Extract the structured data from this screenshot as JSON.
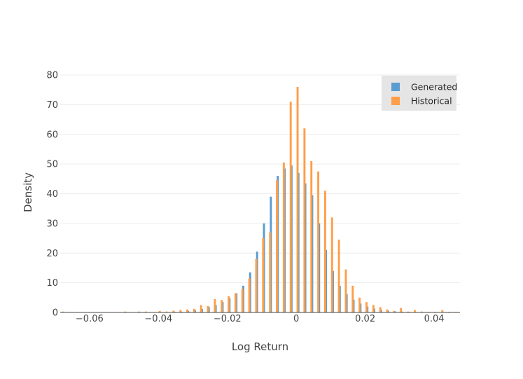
{
  "chart_data": {
    "type": "bar",
    "title": "",
    "xlabel": "Log Return",
    "ylabel": "Density",
    "xlim": [
      -0.0685,
      0.0475
    ],
    "ylim": [
      0,
      80
    ],
    "grid": true,
    "legend_position": "top-right",
    "x_ticks": [
      -0.06,
      -0.04,
      -0.02,
      0,
      0.02,
      0.04
    ],
    "x_tick_labels": [
      "−0.06",
      "−0.04",
      "−0.02",
      "0",
      "0.02",
      "0.04"
    ],
    "y_ticks": [
      0,
      10,
      20,
      30,
      40,
      50,
      60,
      70,
      80
    ],
    "y_tick_labels": [
      "0",
      "10",
      "20",
      "30",
      "40",
      "50",
      "60",
      "70",
      "80"
    ],
    "colors": {
      "Generated": "#5a9bd0",
      "Historical": "#ff9e48"
    },
    "series": [
      {
        "name": "Generated",
        "x": [
          -0.035,
          -0.033,
          -0.031,
          -0.029,
          -0.027,
          -0.025,
          -0.023,
          -0.021,
          -0.019,
          -0.017,
          -0.015,
          -0.013,
          -0.011,
          -0.009,
          -0.007,
          -0.005,
          -0.003,
          -0.001,
          0.001,
          0.003,
          0.005,
          0.007,
          0.009,
          0.011,
          0.013,
          0.015,
          0.017,
          0.019,
          0.021,
          0.023,
          0.025,
          0.027,
          0.029,
          0.031,
          0.033,
          0.035,
          0.037
        ],
        "values": [
          0.2,
          0.3,
          0.5,
          0.8,
          1.2,
          1.8,
          2.5,
          3.5,
          4.8,
          6.5,
          9.0,
          13.5,
          20.5,
          30.0,
          39.0,
          46.0,
          48.5,
          49.5,
          47.0,
          43.5,
          39.5,
          30.0,
          21.0,
          14.0,
          9.0,
          6.2,
          4.3,
          3.0,
          2.0,
          1.3,
          0.9,
          0.6,
          0.4,
          0.3,
          0.2,
          0.1,
          0.1
        ]
      },
      {
        "name": "Historical",
        "x": [
          -0.068,
          -0.05,
          -0.046,
          -0.044,
          -0.04,
          -0.038,
          -0.036,
          -0.034,
          -0.032,
          -0.03,
          -0.028,
          -0.026,
          -0.024,
          -0.022,
          -0.02,
          -0.018,
          -0.016,
          -0.014,
          -0.012,
          -0.01,
          -0.008,
          -0.006,
          -0.004,
          -0.002,
          0.0,
          0.002,
          0.004,
          0.006,
          0.008,
          0.01,
          0.012,
          0.014,
          0.016,
          0.018,
          0.02,
          0.022,
          0.024,
          0.026,
          0.028,
          0.03,
          0.032,
          0.034,
          0.036,
          0.038,
          0.04,
          0.042,
          0.044,
          0.046
        ],
        "values": [
          0.3,
          0.3,
          0.3,
          0.3,
          0.5,
          0.3,
          0.6,
          0.8,
          1.0,
          1.2,
          2.5,
          2.2,
          4.5,
          4.2,
          5.5,
          6.5,
          8.0,
          11.5,
          18.0,
          25.0,
          27.0,
          44.5,
          50.5,
          71.0,
          76.0,
          62.0,
          51.0,
          47.5,
          41.0,
          32.0,
          24.5,
          14.5,
          9.0,
          5.0,
          3.5,
          2.5,
          1.8,
          1.0,
          0.5,
          1.5,
          0.3,
          0.8,
          0.3,
          0.2,
          0.2,
          0.8,
          0.2,
          0.2
        ]
      }
    ]
  }
}
